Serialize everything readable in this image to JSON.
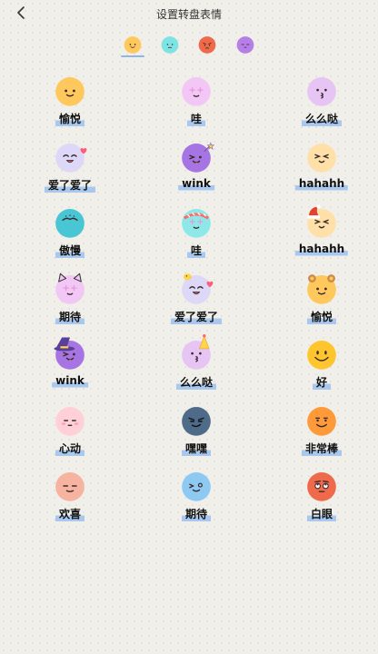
{
  "header": {
    "title": "设置转盘表情",
    "back_icon": "chevron-left-icon"
  },
  "tabs": [
    {
      "color": "#ffc85c",
      "face": "smile",
      "selected": true
    },
    {
      "color": "#7ee3e3",
      "face": "worried",
      "selected": false
    },
    {
      "color": "#ee6a4a",
      "face": "angry",
      "selected": false
    },
    {
      "color": "#b57ee8",
      "face": "sleepy",
      "selected": false
    }
  ],
  "emotes": [
    {
      "label": "愉悦",
      "color": "#ffc85c",
      "face": "smile",
      "decor": ""
    },
    {
      "label": "哇",
      "color": "#f3c7f5",
      "face": "sparkle",
      "decor": ""
    },
    {
      "label": "么么哒",
      "color": "#e6c4f4",
      "face": "kiss",
      "decor": ""
    },
    {
      "label": "爱了爱了",
      "color": "#ddd8f8",
      "face": "happy",
      "decor": "hearts"
    },
    {
      "label": "wink",
      "color": "#a675e3",
      "face": "wink",
      "decor": "wand"
    },
    {
      "label": "hahahh",
      "color": "#ffe0a8",
      "face": "laugh",
      "decor": ""
    },
    {
      "label": "傲慢",
      "color": "#48c6d4",
      "face": "arrogant",
      "decor": ""
    },
    {
      "label": "哇",
      "color": "#8ee8e8",
      "face": "sparkle",
      "decor": "band"
    },
    {
      "label": "hahahh",
      "color": "#ffe0a8",
      "face": "laugh",
      "decor": "santa-hat"
    },
    {
      "label": "期待",
      "color": "#f3c7f5",
      "face": "sparkle",
      "decor": "cat-ears"
    },
    {
      "label": "爱了爱了",
      "color": "#ddd8f8",
      "face": "happy",
      "decor": "chick-heart"
    },
    {
      "label": "愉悦",
      "color": "#ffc85c",
      "face": "smile",
      "decor": "bear-ears"
    },
    {
      "label": "wink",
      "color": "#a675e3",
      "face": "wink",
      "decor": "witch-hat"
    },
    {
      "label": "么么哒",
      "color": "#e6c4f4",
      "face": "kiss",
      "decor": "party-hat"
    },
    {
      "label": "好",
      "color": "#ffc52e",
      "face": "big-smile",
      "decor": ""
    },
    {
      "label": "心动",
      "color": "#ffd0d8",
      "face": "shy",
      "decor": ""
    },
    {
      "label": "嘿嘿",
      "color": "#4e6b89",
      "face": "smirk",
      "decor": ""
    },
    {
      "label": "非常棒",
      "color": "#ff9a3a",
      "face": "grin",
      "decor": ""
    },
    {
      "label": "欢喜",
      "color": "#f6b4a0",
      "face": "content",
      "decor": ""
    },
    {
      "label": "期待",
      "color": "#8ec9f2",
      "face": "wink-tongue",
      "decor": ""
    },
    {
      "label": "白眼",
      "color": "#ee6a4a",
      "face": "eye-roll",
      "decor": ""
    }
  ]
}
